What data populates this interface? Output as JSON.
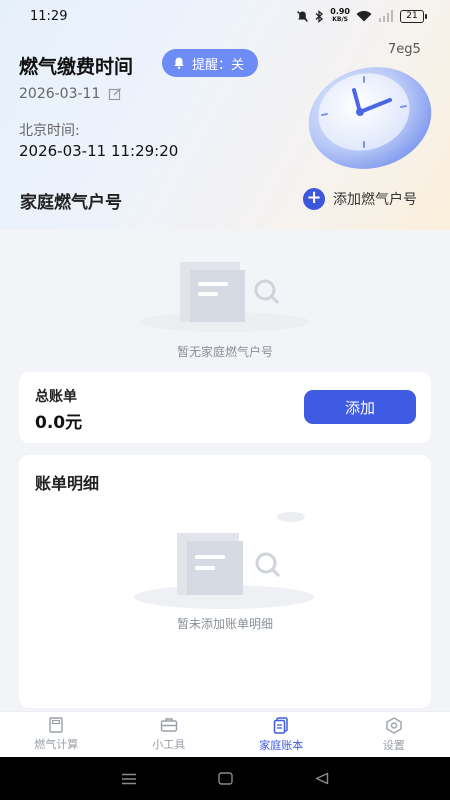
{
  "status_bar": {
    "time": "11:29",
    "speed_value": "0.90",
    "speed_unit": "KB/S",
    "battery": "21"
  },
  "header": {
    "title": "燃气缴费时间",
    "reminder_label": "提醒：关",
    "code": "7eg5",
    "date": "2026-03-11",
    "beijing_label": "北京时间:",
    "beijing_time": "2026-03-11 11:29:20"
  },
  "accounts": {
    "title": "家庭燃气户号",
    "add_label": "添加燃气户号",
    "empty_text": "暂无家庭燃气户号"
  },
  "total_card": {
    "label": "总账单",
    "value": "0.0元",
    "add_button": "添加"
  },
  "detail_card": {
    "title": "账单明细",
    "empty_text": "暂未添加账单明细"
  },
  "tabbar": {
    "tabs": [
      {
        "label": "燃气计算",
        "icon": "calculator-icon"
      },
      {
        "label": "小工具",
        "icon": "toolbox-icon"
      },
      {
        "label": "家庭账本",
        "icon": "ledger-icon",
        "active": true
      },
      {
        "label": "设置",
        "icon": "settings-icon"
      }
    ]
  },
  "colors": {
    "accent": "#3f5be3",
    "pill": "#6e8cf6",
    "background": "#f3f4f7"
  }
}
